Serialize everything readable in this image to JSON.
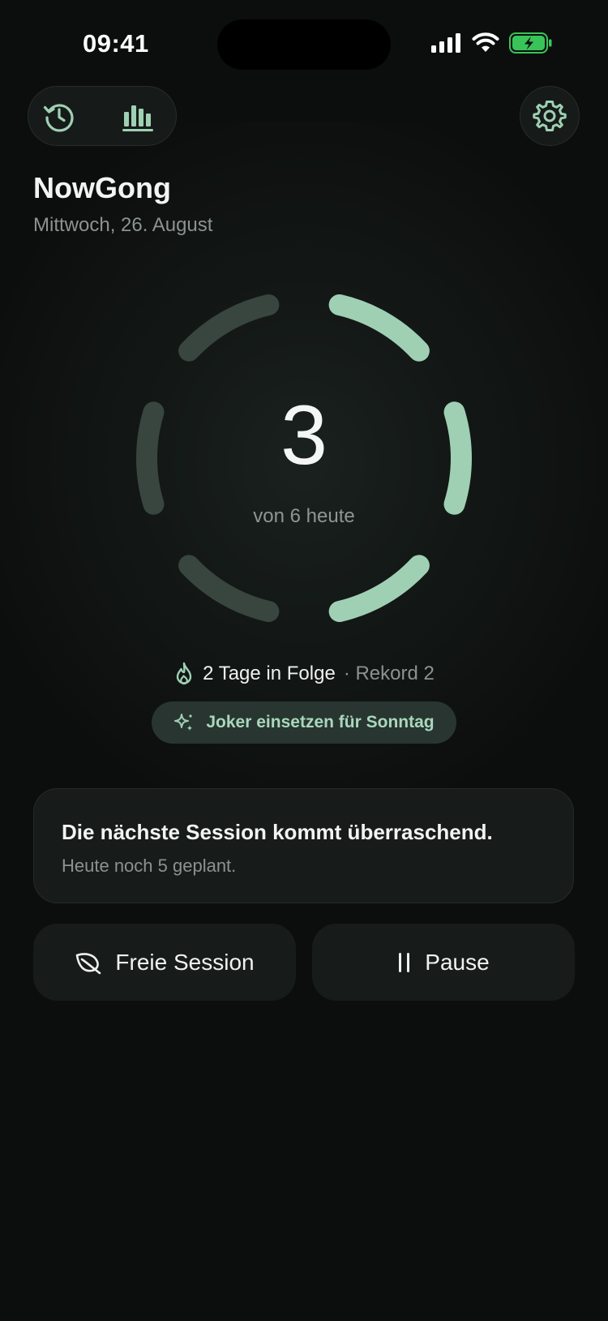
{
  "status_bar": {
    "time": "09:41"
  },
  "header": {
    "history_icon": "history-icon",
    "stats_icon": "bar-chart-icon",
    "settings_icon": "gear-icon"
  },
  "app": {
    "title": "NowGong",
    "date": "Mittwoch, 26. August"
  },
  "progress": {
    "count": "3",
    "subtitle": "von 6 heute",
    "completed": 3,
    "total": 6,
    "active_color": "#9fd0b4",
    "inactive_color": "#38463f"
  },
  "streak": {
    "icon": "flame-icon",
    "label": "2 Tage in Folge",
    "record": "· Rekord 2"
  },
  "joker": {
    "icon": "sparkle-icon",
    "label": "Joker einsetzen für Sonntag"
  },
  "info_card": {
    "title": "Die nächste Session kommt überraschend.",
    "subtitle": "Heute noch 5 geplant."
  },
  "actions": {
    "free_session": {
      "icon": "leaf-icon",
      "label": "Freie Session"
    },
    "pause": {
      "icon": "pause-icon",
      "label": "Pause"
    }
  },
  "colors": {
    "accent": "#9fd0b4",
    "background": "#0c0e0d"
  }
}
